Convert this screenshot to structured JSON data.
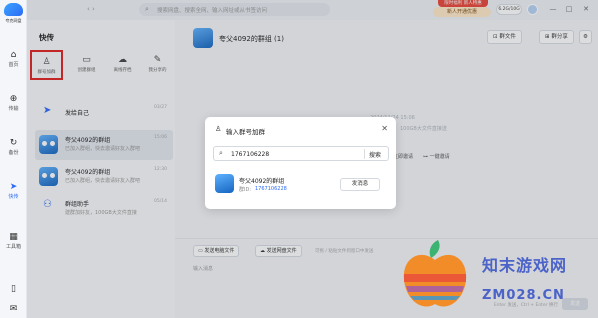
{
  "app": {
    "logo_text": "夸克网盘"
  },
  "rail": {
    "items": [
      {
        "label": "首页",
        "icon": "home-icon"
      },
      {
        "label": "传输",
        "icon": "transfer-icon"
      },
      {
        "label": "备份",
        "icon": "backup-icon"
      },
      {
        "label": "快传",
        "icon": "quick-transfer-icon"
      },
      {
        "label": "工具箱",
        "icon": "toolbox-icon"
      }
    ]
  },
  "topbar": {
    "search_placeholder": "搜索网盘、搜索全网、输入网址或从书签访问",
    "promo_top": "限时福利 新人特惠",
    "promo_main": "新人开通优惠",
    "storage": "6.2G/10G",
    "minimize": "—",
    "maximize": "□",
    "close": "✕"
  },
  "panel": {
    "title": "快传",
    "actions": [
      {
        "label": "群号加群",
        "icon": "add-user-icon"
      },
      {
        "label": "创建群组",
        "icon": "create-group-icon"
      },
      {
        "label": "离线存档",
        "icon": "cloud-icon"
      },
      {
        "label": "我分享的",
        "icon": "share-edit-icon"
      }
    ],
    "chats": [
      {
        "name": "发给自己",
        "sub": "",
        "time": "03/27"
      },
      {
        "name": "夸父4092的群组",
        "sub": "已加入群组，快去邀请好友入群吧",
        "time": "15:06"
      },
      {
        "name": "夸父4092的群组",
        "sub": "已加入群组，快去邀请好友入群吧",
        "time": "12:30"
      },
      {
        "name": "群组助手",
        "sub": "建群加好友，100GB大文件直接",
        "time": "05/14"
      }
    ]
  },
  "main": {
    "title": "夸父4092的群组 (1)",
    "group_file_btn": "群文件",
    "group_share_btn": "群分享",
    "timestamp": "2024/11/24 15:06",
    "stamp_sub": "100GB大文件直接送",
    "float_btns": [
      "立即邀请",
      "一键邀请"
    ],
    "send_local": "发送电脑文件",
    "send_cloud": "发送网盘文件",
    "send_hint": "可拖 / 粘贴文件到窗口中发送",
    "input_placeholder": "输入消息",
    "send_key_hint": "Enter 发送，Ctrl + Enter 换行",
    "send_btn": "发送"
  },
  "dialog": {
    "title": "输入群号加群",
    "search_value": "1767106228",
    "search_btn": "搜索",
    "result_name": "夸父4092的群组",
    "result_id_label": "群ID:",
    "result_id": "1767106228",
    "result_btn": "发消息"
  },
  "watermark": {
    "title": "知末游戏网",
    "url": "ZM028.CN"
  },
  "colors": {
    "accent": "#2d6bf6",
    "highlight": "#e02020",
    "watermark": "#4b63c8"
  }
}
